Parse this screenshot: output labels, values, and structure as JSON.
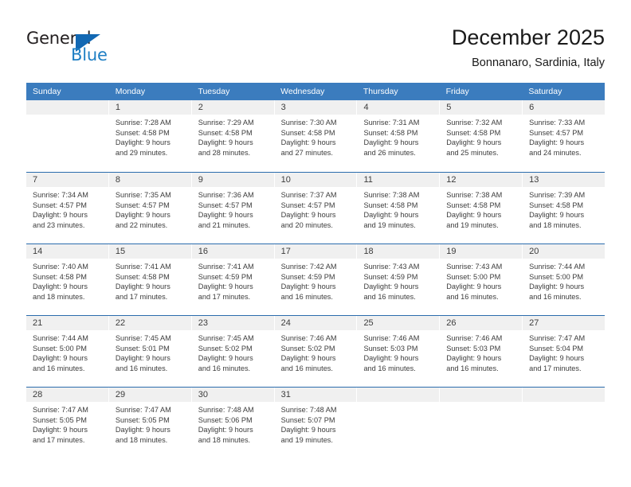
{
  "brand": {
    "name_top": "General",
    "name_bottom": "Blue",
    "accent_color": "#1268b3",
    "text_color": "#231f20"
  },
  "header": {
    "title": "December 2025",
    "subtitle": "Bonnanaro, Sardinia, Italy"
  },
  "calendar": {
    "header_bg": "#3b7cbe",
    "row_divider_color": "#2b6cad",
    "day_band_bg": "#f0f0f0",
    "weekdays": [
      "Sunday",
      "Monday",
      "Tuesday",
      "Wednesday",
      "Thursday",
      "Friday",
      "Saturday"
    ],
    "weeks": [
      [
        {
          "day": "",
          "lines": []
        },
        {
          "day": "1",
          "lines": [
            "Sunrise: 7:28 AM",
            "Sunset: 4:58 PM",
            "Daylight: 9 hours",
            "and 29 minutes."
          ]
        },
        {
          "day": "2",
          "lines": [
            "Sunrise: 7:29 AM",
            "Sunset: 4:58 PM",
            "Daylight: 9 hours",
            "and 28 minutes."
          ]
        },
        {
          "day": "3",
          "lines": [
            "Sunrise: 7:30 AM",
            "Sunset: 4:58 PM",
            "Daylight: 9 hours",
            "and 27 minutes."
          ]
        },
        {
          "day": "4",
          "lines": [
            "Sunrise: 7:31 AM",
            "Sunset: 4:58 PM",
            "Daylight: 9 hours",
            "and 26 minutes."
          ]
        },
        {
          "day": "5",
          "lines": [
            "Sunrise: 7:32 AM",
            "Sunset: 4:58 PM",
            "Daylight: 9 hours",
            "and 25 minutes."
          ]
        },
        {
          "day": "6",
          "lines": [
            "Sunrise: 7:33 AM",
            "Sunset: 4:57 PM",
            "Daylight: 9 hours",
            "and 24 minutes."
          ]
        }
      ],
      [
        {
          "day": "7",
          "lines": [
            "Sunrise: 7:34 AM",
            "Sunset: 4:57 PM",
            "Daylight: 9 hours",
            "and 23 minutes."
          ]
        },
        {
          "day": "8",
          "lines": [
            "Sunrise: 7:35 AM",
            "Sunset: 4:57 PM",
            "Daylight: 9 hours",
            "and 22 minutes."
          ]
        },
        {
          "day": "9",
          "lines": [
            "Sunrise: 7:36 AM",
            "Sunset: 4:57 PM",
            "Daylight: 9 hours",
            "and 21 minutes."
          ]
        },
        {
          "day": "10",
          "lines": [
            "Sunrise: 7:37 AM",
            "Sunset: 4:57 PM",
            "Daylight: 9 hours",
            "and 20 minutes."
          ]
        },
        {
          "day": "11",
          "lines": [
            "Sunrise: 7:38 AM",
            "Sunset: 4:58 PM",
            "Daylight: 9 hours",
            "and 19 minutes."
          ]
        },
        {
          "day": "12",
          "lines": [
            "Sunrise: 7:38 AM",
            "Sunset: 4:58 PM",
            "Daylight: 9 hours",
            "and 19 minutes."
          ]
        },
        {
          "day": "13",
          "lines": [
            "Sunrise: 7:39 AM",
            "Sunset: 4:58 PM",
            "Daylight: 9 hours",
            "and 18 minutes."
          ]
        }
      ],
      [
        {
          "day": "14",
          "lines": [
            "Sunrise: 7:40 AM",
            "Sunset: 4:58 PM",
            "Daylight: 9 hours",
            "and 18 minutes."
          ]
        },
        {
          "day": "15",
          "lines": [
            "Sunrise: 7:41 AM",
            "Sunset: 4:58 PM",
            "Daylight: 9 hours",
            "and 17 minutes."
          ]
        },
        {
          "day": "16",
          "lines": [
            "Sunrise: 7:41 AM",
            "Sunset: 4:59 PM",
            "Daylight: 9 hours",
            "and 17 minutes."
          ]
        },
        {
          "day": "17",
          "lines": [
            "Sunrise: 7:42 AM",
            "Sunset: 4:59 PM",
            "Daylight: 9 hours",
            "and 16 minutes."
          ]
        },
        {
          "day": "18",
          "lines": [
            "Sunrise: 7:43 AM",
            "Sunset: 4:59 PM",
            "Daylight: 9 hours",
            "and 16 minutes."
          ]
        },
        {
          "day": "19",
          "lines": [
            "Sunrise: 7:43 AM",
            "Sunset: 5:00 PM",
            "Daylight: 9 hours",
            "and 16 minutes."
          ]
        },
        {
          "day": "20",
          "lines": [
            "Sunrise: 7:44 AM",
            "Sunset: 5:00 PM",
            "Daylight: 9 hours",
            "and 16 minutes."
          ]
        }
      ],
      [
        {
          "day": "21",
          "lines": [
            "Sunrise: 7:44 AM",
            "Sunset: 5:00 PM",
            "Daylight: 9 hours",
            "and 16 minutes."
          ]
        },
        {
          "day": "22",
          "lines": [
            "Sunrise: 7:45 AM",
            "Sunset: 5:01 PM",
            "Daylight: 9 hours",
            "and 16 minutes."
          ]
        },
        {
          "day": "23",
          "lines": [
            "Sunrise: 7:45 AM",
            "Sunset: 5:02 PM",
            "Daylight: 9 hours",
            "and 16 minutes."
          ]
        },
        {
          "day": "24",
          "lines": [
            "Sunrise: 7:46 AM",
            "Sunset: 5:02 PM",
            "Daylight: 9 hours",
            "and 16 minutes."
          ]
        },
        {
          "day": "25",
          "lines": [
            "Sunrise: 7:46 AM",
            "Sunset: 5:03 PM",
            "Daylight: 9 hours",
            "and 16 minutes."
          ]
        },
        {
          "day": "26",
          "lines": [
            "Sunrise: 7:46 AM",
            "Sunset: 5:03 PM",
            "Daylight: 9 hours",
            "and 16 minutes."
          ]
        },
        {
          "day": "27",
          "lines": [
            "Sunrise: 7:47 AM",
            "Sunset: 5:04 PM",
            "Daylight: 9 hours",
            "and 17 minutes."
          ]
        }
      ],
      [
        {
          "day": "28",
          "lines": [
            "Sunrise: 7:47 AM",
            "Sunset: 5:05 PM",
            "Daylight: 9 hours",
            "and 17 minutes."
          ]
        },
        {
          "day": "29",
          "lines": [
            "Sunrise: 7:47 AM",
            "Sunset: 5:05 PM",
            "Daylight: 9 hours",
            "and 18 minutes."
          ]
        },
        {
          "day": "30",
          "lines": [
            "Sunrise: 7:48 AM",
            "Sunset: 5:06 PM",
            "Daylight: 9 hours",
            "and 18 minutes."
          ]
        },
        {
          "day": "31",
          "lines": [
            "Sunrise: 7:48 AM",
            "Sunset: 5:07 PM",
            "Daylight: 9 hours",
            "and 19 minutes."
          ]
        },
        {
          "day": "",
          "lines": []
        },
        {
          "day": "",
          "lines": []
        },
        {
          "day": "",
          "lines": []
        }
      ]
    ]
  }
}
